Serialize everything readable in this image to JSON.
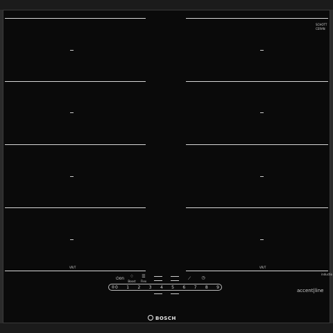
{
  "product": {
    "brand": "BOSCH",
    "line_label": "accent|line",
    "top_left_label": "",
    "top_right_label_1": "SCHOTT",
    "top_right_label_2": "CERAN",
    "right_side_label": "inductio"
  },
  "zones": [
    {
      "name": "left-zone-1"
    },
    {
      "name": "left-zone-2"
    },
    {
      "name": "left-zone-3"
    },
    {
      "name": "left-zone-4"
    },
    {
      "name": "right-zone-1"
    },
    {
      "name": "right-zone-2"
    },
    {
      "name": "right-zone-3"
    },
    {
      "name": "right-zone-4"
    }
  ],
  "controls": {
    "power_label": "on",
    "boost_label": "Boost",
    "flex_label": "Flex",
    "timer_icon": "clock-icon",
    "power_icon": "power-icon",
    "lock_icon": "lock-icon",
    "slider_digits": [
      "0",
      "1",
      "2",
      "3",
      "4",
      "5",
      "6",
      "7",
      "8",
      "9"
    ],
    "flex_badge": "VR/T"
  }
}
